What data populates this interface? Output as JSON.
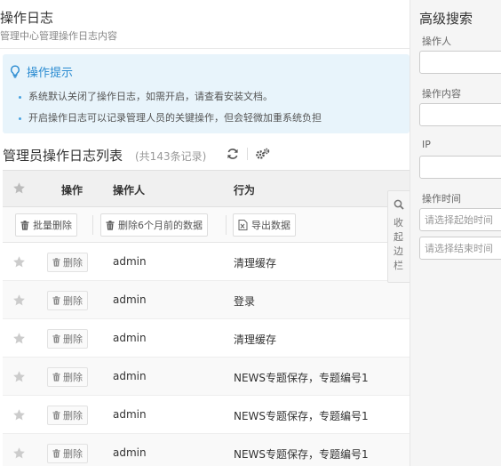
{
  "header": {
    "title": "操作日志",
    "subtitle": "管理中心管理操作日志内容"
  },
  "tips": {
    "title": "操作提示",
    "items": [
      "系统默认关闭了操作日志，如需开启，请查看安装文档。",
      "开启操作日志可以记录管理人员的关键操作，但会轻微加重系统负担"
    ]
  },
  "list": {
    "title": "管理员操作日志列表",
    "count_text": "(共143条记录)",
    "columns": {
      "operate": "操作",
      "operator": "操作人",
      "action": "行为"
    },
    "toolbar": {
      "bulk_delete": "批量删除",
      "delete_old": "删除6个月前的数据",
      "export": "导出数据"
    },
    "delete_label": "删除",
    "rows": [
      {
        "operator": "admin",
        "action": "清理缓存"
      },
      {
        "operator": "admin",
        "action": "登录"
      },
      {
        "operator": "admin",
        "action": "清理缓存"
      },
      {
        "operator": "admin",
        "action": "NEWS专题保存，专题编号1"
      },
      {
        "operator": "admin",
        "action": "NEWS专题保存，专题编号1"
      },
      {
        "operator": "admin",
        "action": "NEWS专题保存，专题编号1"
      }
    ]
  },
  "collapse_sidebar": "收起边栏",
  "search": {
    "title": "高级搜索",
    "operator_label": "操作人",
    "operator_value": "",
    "content_label": "操作内容",
    "content_value": "",
    "ip_label": "IP",
    "ip_value": "",
    "time_label": "操作时间",
    "start_placeholder": "请选择起始时间",
    "end_placeholder": "请选择结束时间"
  },
  "colors": {
    "accent": "#2a8bd1",
    "tips_bg": "#e8f4fb",
    "header_bg": "#f0f0f0"
  },
  "icons": {
    "tips": "lightbulb-icon",
    "refresh": "refresh-icon",
    "settings": "gears-icon",
    "star": "star-icon",
    "delete": "trash-icon",
    "export": "excel-icon",
    "search": "search-icon"
  }
}
